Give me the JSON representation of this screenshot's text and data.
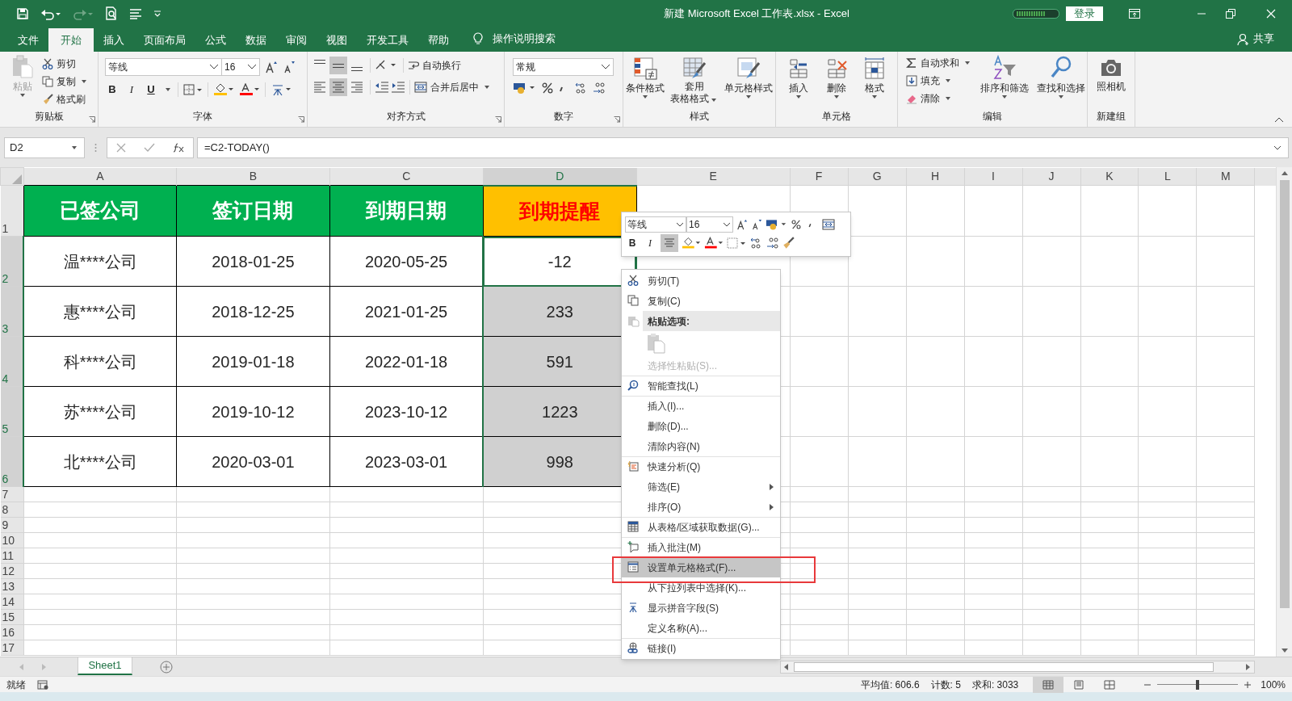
{
  "window": {
    "title": "新建 Microsoft Excel 工作表.xlsx  -  Excel",
    "login": "登录"
  },
  "ribbon_tabs": [
    {
      "label": "文件",
      "selected": false
    },
    {
      "label": "开始",
      "selected": true
    },
    {
      "label": "插入",
      "selected": false
    },
    {
      "label": "页面布局",
      "selected": false
    },
    {
      "label": "公式",
      "selected": false
    },
    {
      "label": "数据",
      "selected": false
    },
    {
      "label": "审阅",
      "selected": false
    },
    {
      "label": "视图",
      "selected": false
    },
    {
      "label": "开发工具",
      "selected": false
    },
    {
      "label": "帮助",
      "selected": false
    }
  ],
  "tell_me": "操作说明搜索",
  "share": "共享",
  "ribbon": {
    "clipboard": {
      "label": "剪贴板",
      "paste": "粘贴",
      "cut": "剪切",
      "copy": "复制",
      "format_painter": "格式刷"
    },
    "font": {
      "label": "字体",
      "font_name": "等线",
      "font_size": "16",
      "bold": "B",
      "italic": "I",
      "underline": "U"
    },
    "alignment": {
      "label": "对齐方式",
      "wrap_text": "自动换行",
      "merge_center": "合并后居中",
      "vertical": [
        {
          "selected": false
        },
        {
          "selected": true
        },
        {
          "selected": false
        }
      ],
      "horizontal": [
        {
          "selected": false
        },
        {
          "selected": true
        },
        {
          "selected": false
        }
      ]
    },
    "number": {
      "label": "数字",
      "format": "常规"
    },
    "styles": {
      "label": "样式",
      "conditional": "条件格式",
      "table_format": [
        "套用",
        "表格格式"
      ],
      "cell_styles": "单元格样式"
    },
    "cells": {
      "label": "单元格",
      "insert": "插入",
      "delete": "删除",
      "format": "格式"
    },
    "editing": {
      "label": "编辑",
      "autosum": "自动求和",
      "fill": "填充",
      "clear": "清除",
      "sort_filter": "排序和筛选",
      "find_select": "查找和选择"
    },
    "new_group": {
      "label": "新建组",
      "camera": "照相机"
    }
  },
  "formula_bar": {
    "name_box": "D2",
    "formula": "=C2-TODAY()"
  },
  "columns": [
    {
      "label": "A",
      "selected": false
    },
    {
      "label": "B",
      "selected": false
    },
    {
      "label": "C",
      "selected": false
    },
    {
      "label": "D",
      "selected": true
    },
    {
      "label": "E",
      "selected": false
    },
    {
      "label": "F",
      "selected": false
    },
    {
      "label": "G",
      "selected": false
    },
    {
      "label": "H",
      "selected": false
    },
    {
      "label": "I",
      "selected": false
    },
    {
      "label": "J",
      "selected": false
    },
    {
      "label": "K",
      "selected": false
    },
    {
      "label": "L",
      "selected": false
    },
    {
      "label": "M",
      "selected": false
    }
  ],
  "rows": [
    {
      "label": "1",
      "selected": false,
      "cells": [
        {
          "text": "已签公司",
          "kind": "header",
          "selected": false,
          "active": false
        },
        {
          "text": "签订日期",
          "kind": "header",
          "selected": false,
          "active": false
        },
        {
          "text": "到期日期",
          "kind": "header",
          "selected": false,
          "active": false
        },
        {
          "text": "到期提醒",
          "kind": "alert_header",
          "selected": false,
          "active": false
        }
      ]
    },
    {
      "label": "2",
      "selected": true,
      "cells": [
        {
          "text": "温****公司",
          "kind": "data",
          "selected": false,
          "active": false
        },
        {
          "text": "2018-01-25",
          "kind": "data",
          "selected": false,
          "active": false
        },
        {
          "text": "2020-05-25",
          "kind": "data",
          "selected": false,
          "active": false
        },
        {
          "text": "-12",
          "kind": "data",
          "selected": true,
          "active": true
        }
      ]
    },
    {
      "label": "3",
      "selected": true,
      "cells": [
        {
          "text": "惠****公司",
          "kind": "data",
          "selected": false,
          "active": false
        },
        {
          "text": "2018-12-25",
          "kind": "data",
          "selected": false,
          "active": false
        },
        {
          "text": "2021-01-25",
          "kind": "data",
          "selected": false,
          "active": false
        },
        {
          "text": "233",
          "kind": "data",
          "selected": true,
          "active": false
        }
      ]
    },
    {
      "label": "4",
      "selected": true,
      "cells": [
        {
          "text": "科****公司",
          "kind": "data",
          "selected": false,
          "active": false
        },
        {
          "text": "2019-01-18",
          "kind": "data",
          "selected": false,
          "active": false
        },
        {
          "text": "2022-01-18",
          "kind": "data",
          "selected": false,
          "active": false
        },
        {
          "text": "591",
          "kind": "data",
          "selected": true,
          "active": false
        }
      ]
    },
    {
      "label": "5",
      "selected": true,
      "cells": [
        {
          "text": "苏****公司",
          "kind": "data",
          "selected": false,
          "active": false
        },
        {
          "text": "2019-10-12",
          "kind": "data",
          "selected": false,
          "active": false
        },
        {
          "text": "2023-10-12",
          "kind": "data",
          "selected": false,
          "active": false
        },
        {
          "text": "1223",
          "kind": "data",
          "selected": true,
          "active": false
        }
      ]
    },
    {
      "label": "6",
      "selected": true,
      "cells": [
        {
          "text": "北****公司",
          "kind": "data",
          "selected": false,
          "active": false
        },
        {
          "text": "2020-03-01",
          "kind": "data",
          "selected": false,
          "active": false
        },
        {
          "text": "2023-03-01",
          "kind": "data",
          "selected": false,
          "active": false
        },
        {
          "text": "998",
          "kind": "data",
          "selected": true,
          "active": false
        }
      ]
    },
    {
      "label": "7",
      "selected": false
    },
    {
      "label": "8",
      "selected": false
    },
    {
      "label": "9",
      "selected": false
    },
    {
      "label": "10",
      "selected": false
    },
    {
      "label": "11",
      "selected": false
    },
    {
      "label": "12",
      "selected": false
    },
    {
      "label": "13",
      "selected": false
    },
    {
      "label": "14",
      "selected": false
    },
    {
      "label": "15",
      "selected": false
    },
    {
      "label": "16",
      "selected": false
    },
    {
      "label": "17",
      "selected": false
    }
  ],
  "mini_toolbar": {
    "font_name": "等线",
    "font_size": "16",
    "bold": "B",
    "italic": "I",
    "align_center": {
      "selected": true
    }
  },
  "context_menu": [
    {
      "kind": "item",
      "label": "剪切(T)",
      "disabled": false,
      "selected": false,
      "submenu": false,
      "separator_before": false
    },
    {
      "kind": "item",
      "label": "复制(C)",
      "disabled": false,
      "selected": false,
      "submenu": false,
      "separator_before": false
    },
    {
      "kind": "section",
      "label": "粘贴选项:",
      "disabled": false,
      "selected": false,
      "submenu": false,
      "separator_before": false
    },
    {
      "kind": "paste_options",
      "disabled": true,
      "selected": false,
      "submenu": false,
      "separator_before": false
    },
    {
      "kind": "item",
      "label": "选择性粘贴(S)...",
      "disabled": true,
      "selected": false,
      "submenu": false,
      "separator_before": false
    },
    {
      "kind": "item",
      "label": "智能查找(L)",
      "disabled": false,
      "selected": false,
      "submenu": false,
      "separator_before": true
    },
    {
      "kind": "item",
      "label": "插入(I)...",
      "disabled": false,
      "selected": false,
      "submenu": false,
      "separator_before": true
    },
    {
      "kind": "item",
      "label": "删除(D)...",
      "disabled": false,
      "selected": false,
      "submenu": false,
      "separator_before": false
    },
    {
      "kind": "item",
      "label": "清除内容(N)",
      "disabled": false,
      "selected": false,
      "submenu": false,
      "separator_before": false
    },
    {
      "kind": "item",
      "label": "快速分析(Q)",
      "disabled": false,
      "selected": false,
      "submenu": false,
      "separator_before": true
    },
    {
      "kind": "item",
      "label": "筛选(E)",
      "disabled": false,
      "selected": false,
      "submenu": true,
      "separator_before": false
    },
    {
      "kind": "item",
      "label": "排序(O)",
      "disabled": false,
      "selected": false,
      "submenu": true,
      "separator_before": false
    },
    {
      "kind": "item",
      "label": "从表格/区域获取数据(G)...",
      "disabled": false,
      "selected": false,
      "submenu": false,
      "separator_before": true
    },
    {
      "kind": "item",
      "label": "插入批注(M)",
      "disabled": false,
      "selected": false,
      "submenu": false,
      "separator_before": true
    },
    {
      "kind": "item",
      "label": "设置单元格格式(F)...",
      "disabled": false,
      "selected": true,
      "submenu": false,
      "separator_before": false
    },
    {
      "kind": "item",
      "label": "从下拉列表中选择(K)...",
      "disabled": false,
      "selected": false,
      "submenu": false,
      "separator_before": false
    },
    {
      "kind": "item",
      "label": "显示拼音字段(S)",
      "disabled": false,
      "selected": false,
      "submenu": false,
      "separator_before": false
    },
    {
      "kind": "item",
      "label": "定义名称(A)...",
      "disabled": false,
      "selected": false,
      "submenu": false,
      "separator_before": false
    },
    {
      "kind": "item",
      "label": "链接(I)",
      "disabled": false,
      "selected": false,
      "submenu": false,
      "separator_before": true
    }
  ],
  "sheet_tabs": [
    {
      "label": "Sheet1",
      "selected": true
    }
  ],
  "status_bar": {
    "mode": "就绪",
    "average": "平均值: 606.6",
    "count": "计数: 5",
    "sum": "求和: 3033",
    "views": [
      {
        "selected": true
      },
      {
        "selected": false
      },
      {
        "selected": false
      }
    ],
    "zoom_slider": {
      "level": 0.5
    },
    "zoom": "100%"
  }
}
